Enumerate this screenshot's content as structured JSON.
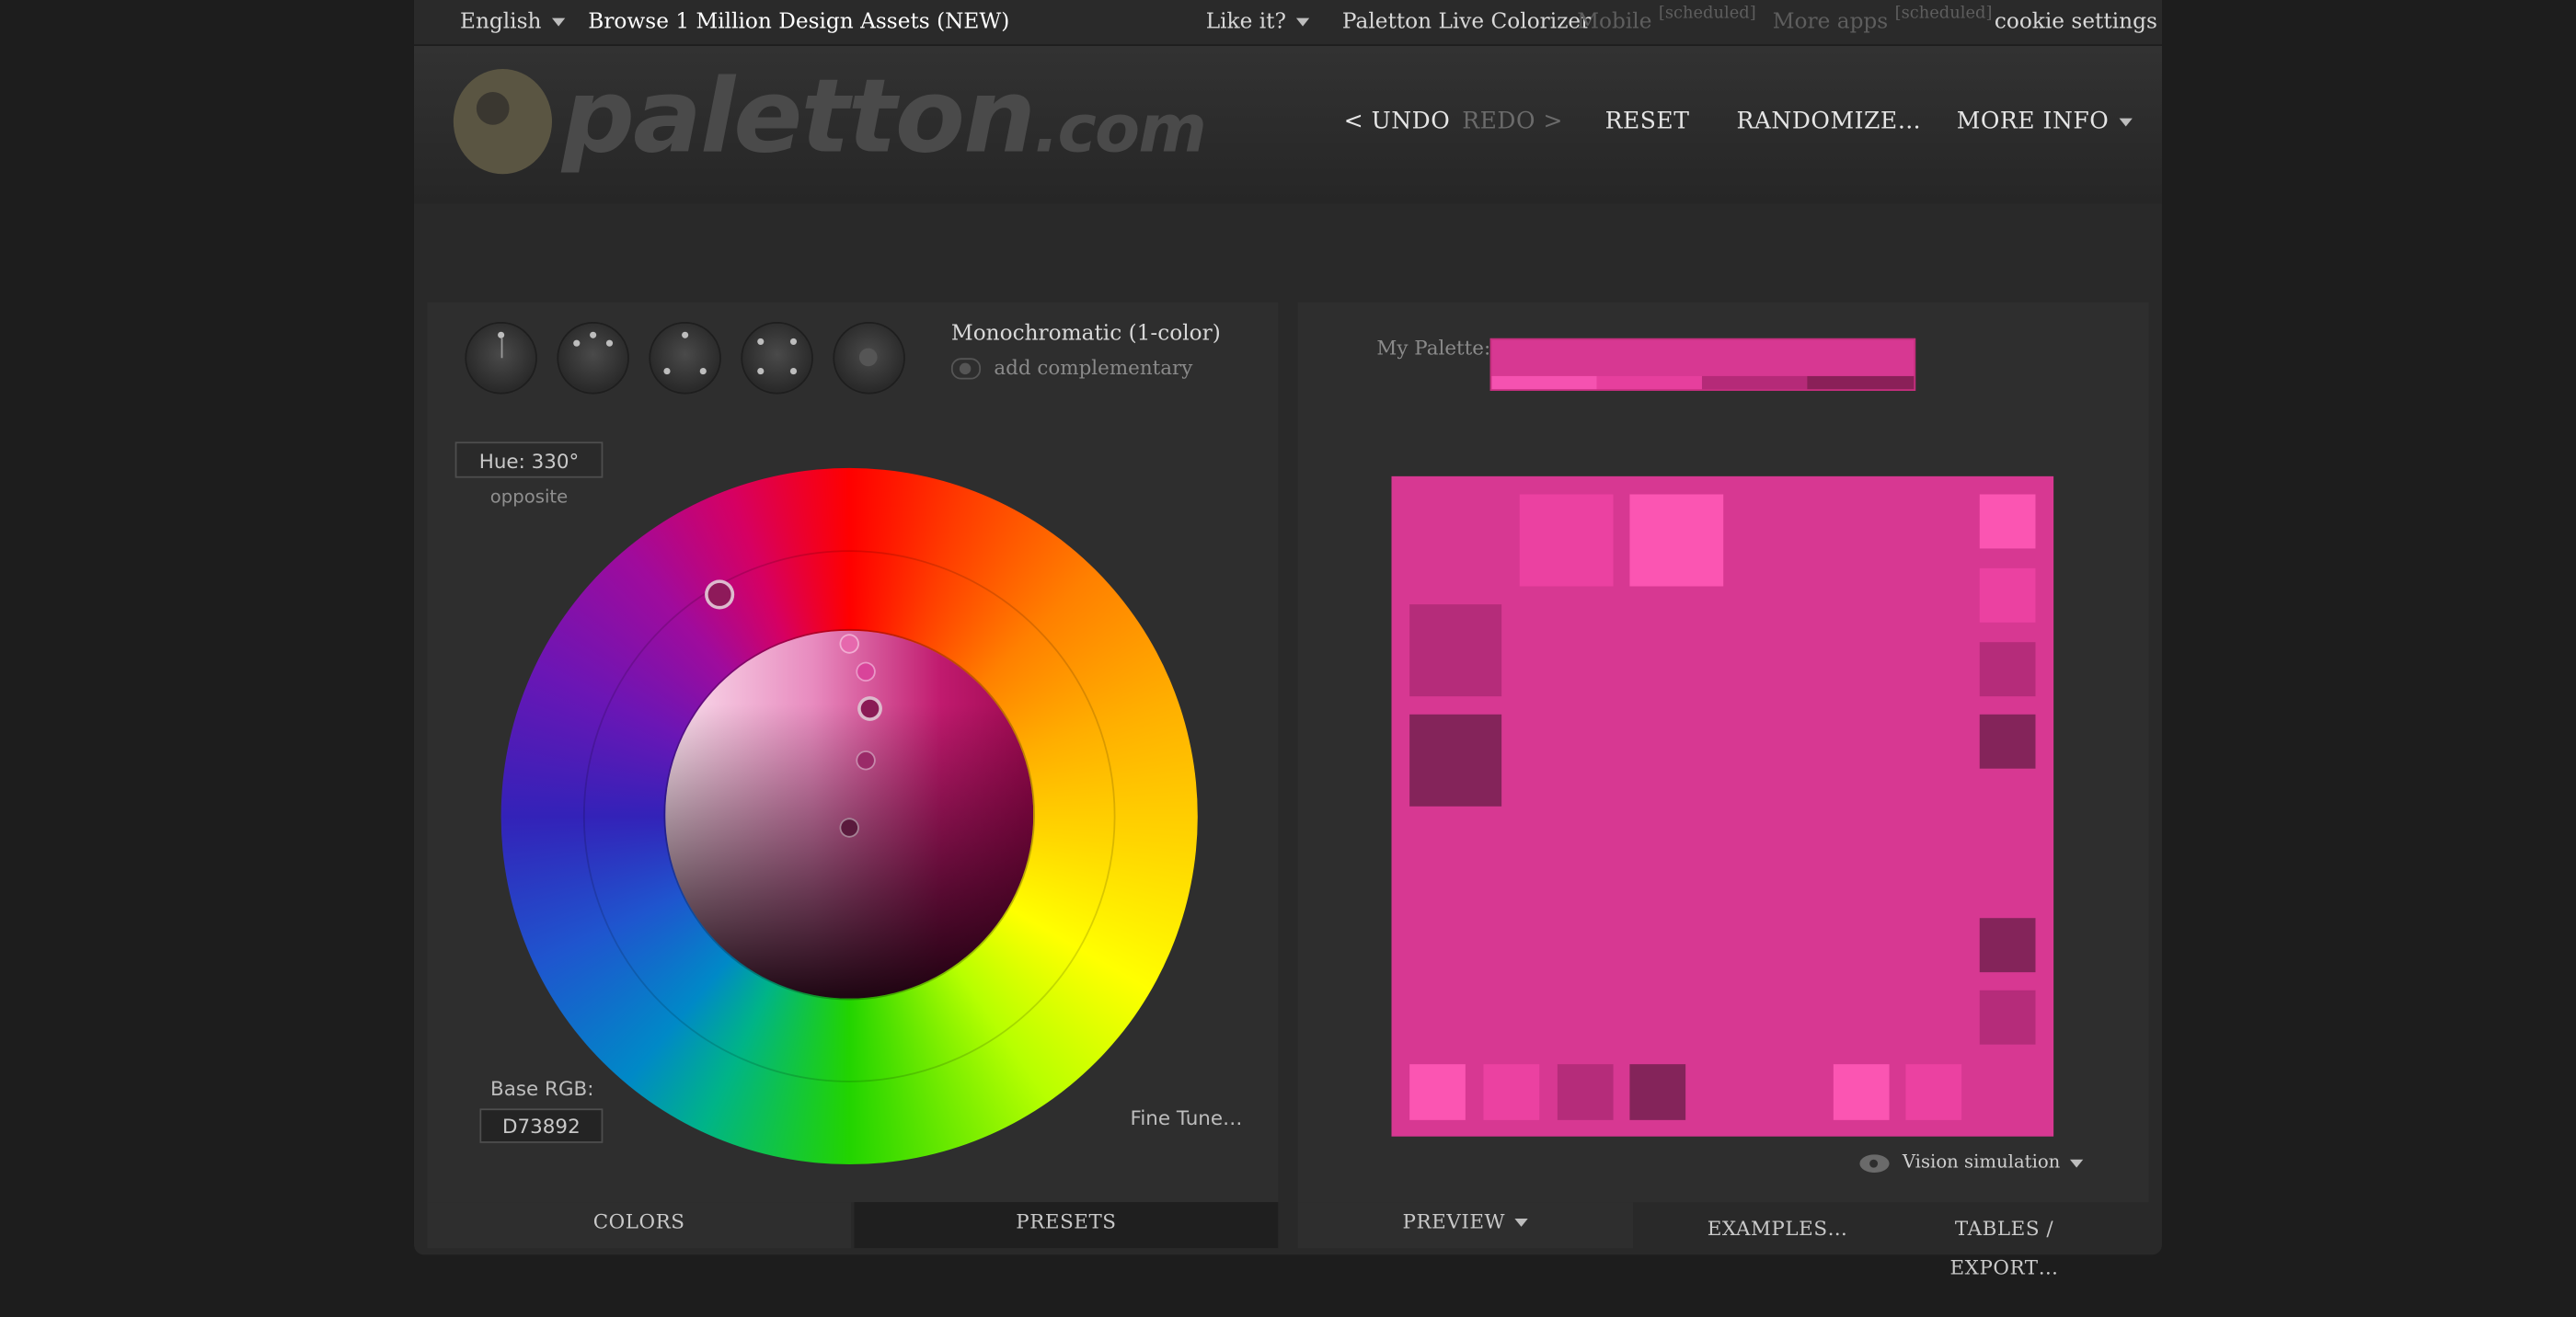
{
  "topbar": {
    "language": "English",
    "browse": "Browse 1 Million Design Assets (NEW)",
    "like_it": "Like it?",
    "live_colorizer": "Paletton Live Colorizer",
    "mobile": "Mobile",
    "mobile_tag": "[scheduled]",
    "more_apps": "More apps",
    "more_apps_tag": "[scheduled]",
    "cookie": "cookie settings"
  },
  "header": {
    "logo_main": "paletton",
    "logo_tld": ".com",
    "undo": "< UNDO",
    "redo": "REDO >",
    "reset": "RESET",
    "randomize": "RANDOMIZE…",
    "more_info": "MORE INFO"
  },
  "colors_panel": {
    "scheme_title": "Monochromatic (1-color)",
    "add_complementary": "add complementary",
    "hue": "Hue: 330°",
    "opposite": "opposite",
    "base_rgb_label": "Base RGB:",
    "base_rgb_value": "D73892",
    "fine_tune": "Fine Tune…",
    "schemes": [
      "mono-icon",
      "adjacent-icon",
      "triad-icon",
      "tetrad-icon",
      "freestyle-icon"
    ]
  },
  "tabs": {
    "colors": "COLORS",
    "presets": "PRESETS",
    "preview": "PREVIEW",
    "examples": "EXAMPLES…",
    "tables": "TABLES / EXPORT…"
  },
  "palette": {
    "label": "My Palette:",
    "base": "#d73892",
    "swatches": [
      "#f552b0",
      "#e63f9d",
      "#b52a78",
      "#8a2058"
    ]
  },
  "preview": {
    "background": "#d73892",
    "vision": "Vision simulation"
  },
  "colors": {
    "base": "#d73892",
    "light2": "#fb55b2",
    "light1": "#eb41a1",
    "dark1": "#b52c7a",
    "dark2": "#84245a"
  }
}
